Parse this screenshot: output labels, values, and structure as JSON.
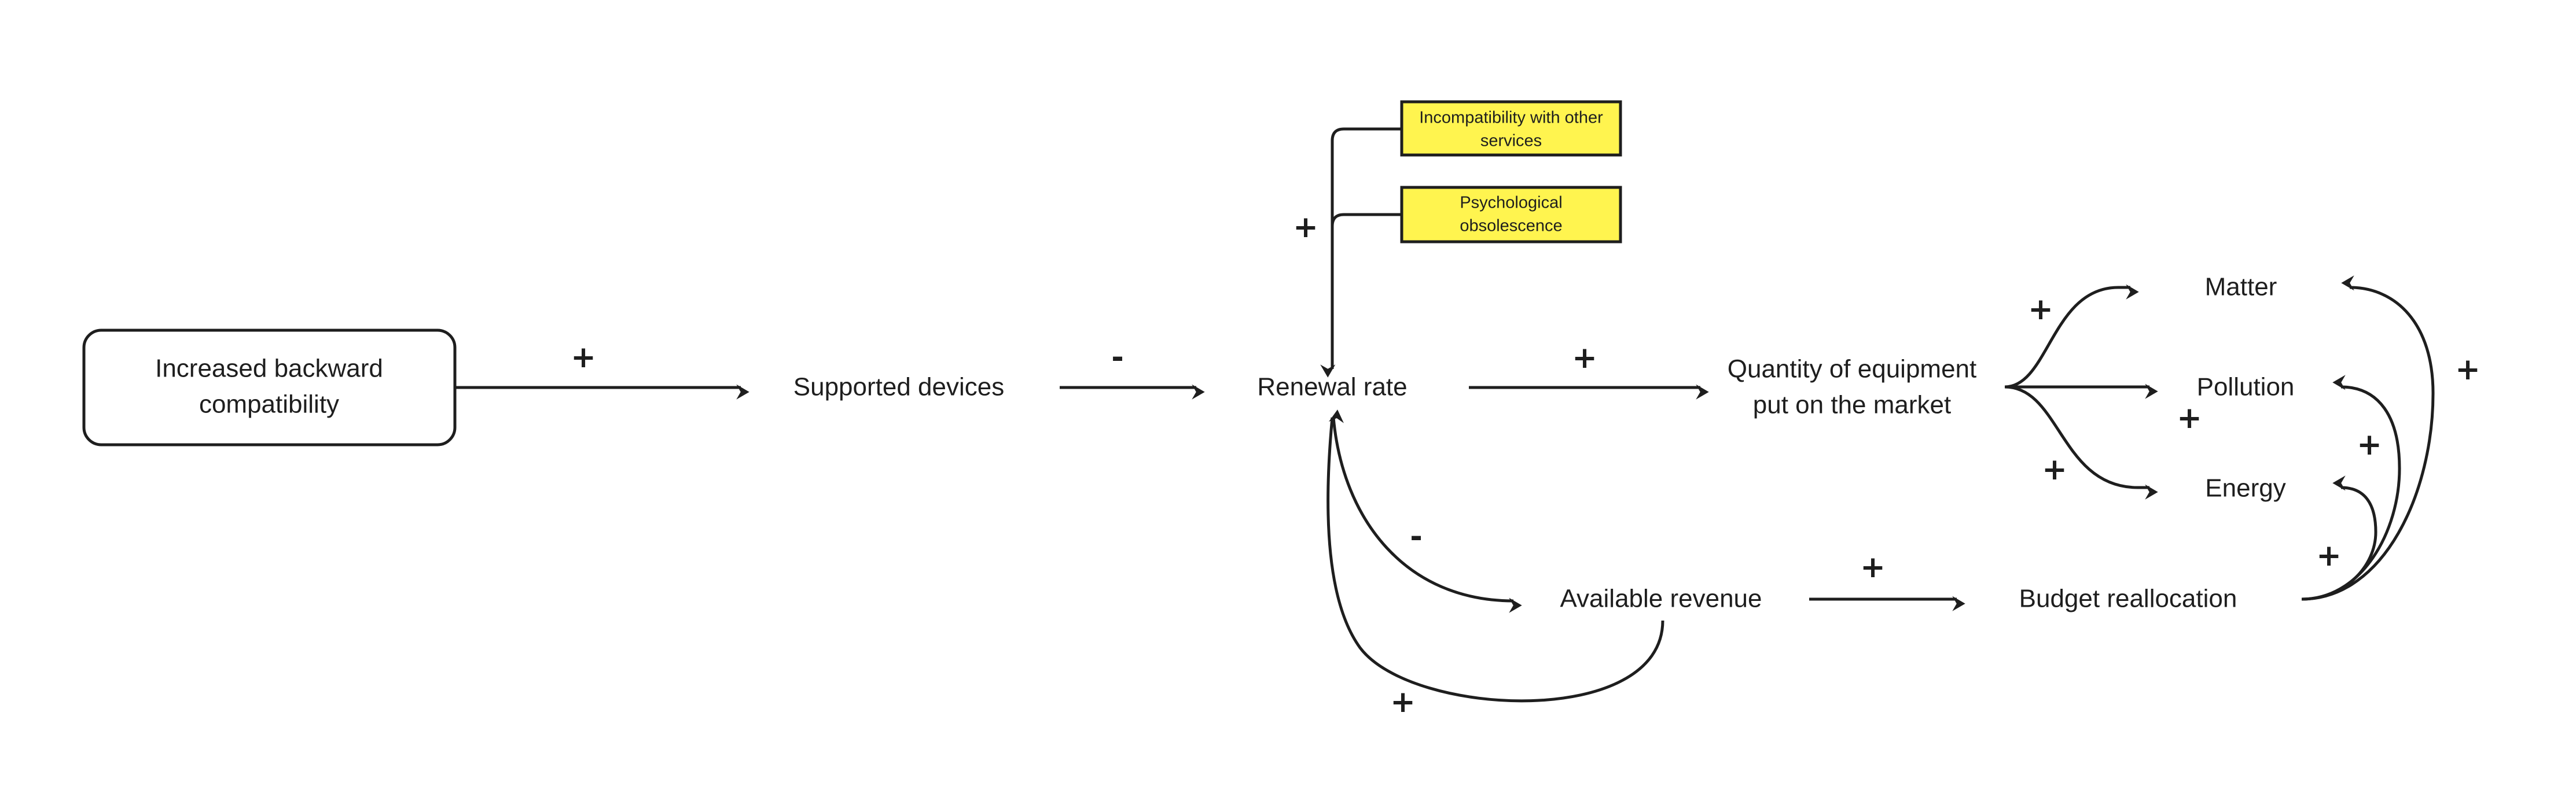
{
  "nodes": {
    "backward_compat": {
      "line1": "Increased backward",
      "line2": "compatibility"
    },
    "supported_devices": "Supported devices",
    "renewal_rate": "Renewal rate",
    "quantity": {
      "line1": "Quantity of equipment",
      "line2": "put on the market"
    },
    "matter": "Matter",
    "pollution": "Pollution",
    "energy": "Energy",
    "available_revenue": "Available revenue",
    "budget_reallocation": "Budget reallocation"
  },
  "notes": {
    "incompatibility": {
      "line1": "Incompatibility with other",
      "line2": "services"
    },
    "psychological": {
      "line1": "Psychological",
      "line2": "obsolescence"
    }
  },
  "polarities": {
    "compat_to_supported": "+",
    "supported_to_renewal": "-",
    "notes_to_renewal": "+",
    "renewal_to_quantity": "+",
    "quantity_to_matter": "+",
    "quantity_to_pollution": "+",
    "quantity_to_energy": "+",
    "renewal_to_revenue": "-",
    "revenue_to_renewal": "+",
    "revenue_to_budget": "+",
    "budget_to_matter": "+",
    "budget_to_pollution": "+",
    "budget_to_energy": "+"
  },
  "colors": {
    "note_fill": "#fff44f",
    "ink": "#1e1e1e"
  }
}
